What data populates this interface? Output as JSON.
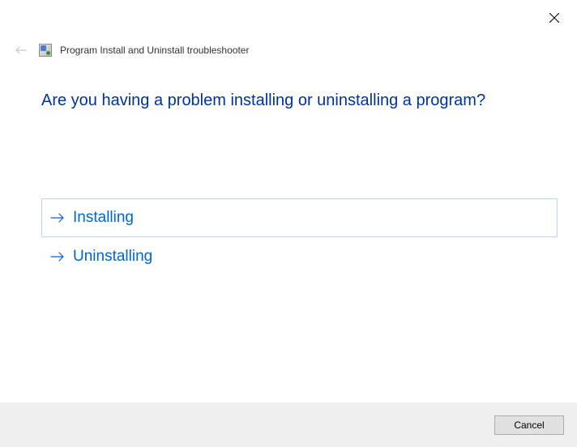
{
  "header": {
    "title": "Program Install and Uninstall troubleshooter"
  },
  "question": "Are you having a problem installing or uninstalling a program?",
  "options": [
    {
      "label": "Installing",
      "selected": true
    },
    {
      "label": "Uninstalling",
      "selected": false
    }
  ],
  "footer": {
    "cancel_label": "Cancel"
  },
  "colors": {
    "accent": "#003399",
    "link": "#0066cc",
    "option_border": "#bdd6f0"
  }
}
